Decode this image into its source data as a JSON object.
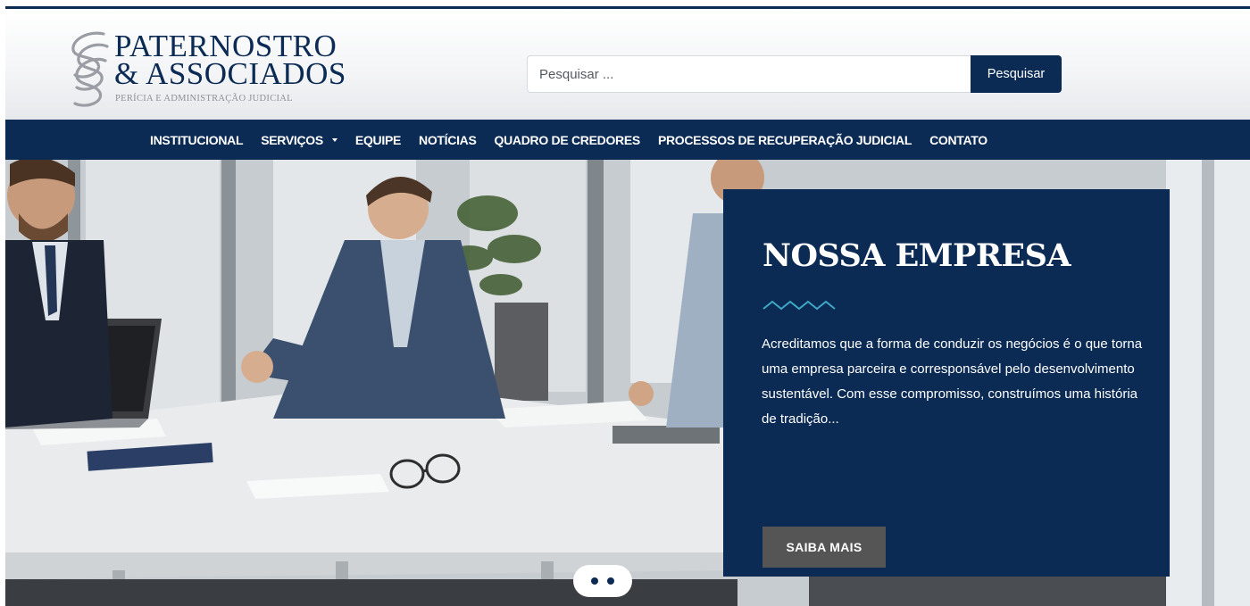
{
  "logo": {
    "line1": "PATERNOSTRO",
    "line2": "& ASSOCIADOS",
    "tagline": "PERÍCIA E ADMINISTRAÇÃO JUDICIAL"
  },
  "search": {
    "placeholder": "Pesquisar ...",
    "button_label": "Pesquisar"
  },
  "nav": {
    "items": [
      {
        "label": "INSTITUCIONAL"
      },
      {
        "label": "SERVIÇOS",
        "has_dropdown": true
      },
      {
        "label": "EQUIPE"
      },
      {
        "label": "NOTÍCIAS"
      },
      {
        "label": "QUADRO DE CREDORES"
      },
      {
        "label": "PROCESSOS DE RECUPERAÇÃO JUDICIAL"
      },
      {
        "label": "CONTATO"
      }
    ]
  },
  "hero": {
    "title": "NOSSA EMPRESA",
    "text": "Acreditamos que a forma de conduzir os negócios é o que torna uma empresa parceira e corresponsável pelo desenvolvimento sustentável. Com esse compromisso, construímos uma história de tradição...",
    "button_label": "SAIBA MAIS",
    "slides": 2,
    "active_slide": 1
  },
  "colors": {
    "brand_navy": "#0b2b55",
    "accent_wave": "#3fa9c8",
    "button_gray": "#555555"
  },
  "icons": {
    "logo_mark": "intertwined-loops-icon",
    "dropdown": "caret-down-icon",
    "divider": "wave-icon"
  }
}
